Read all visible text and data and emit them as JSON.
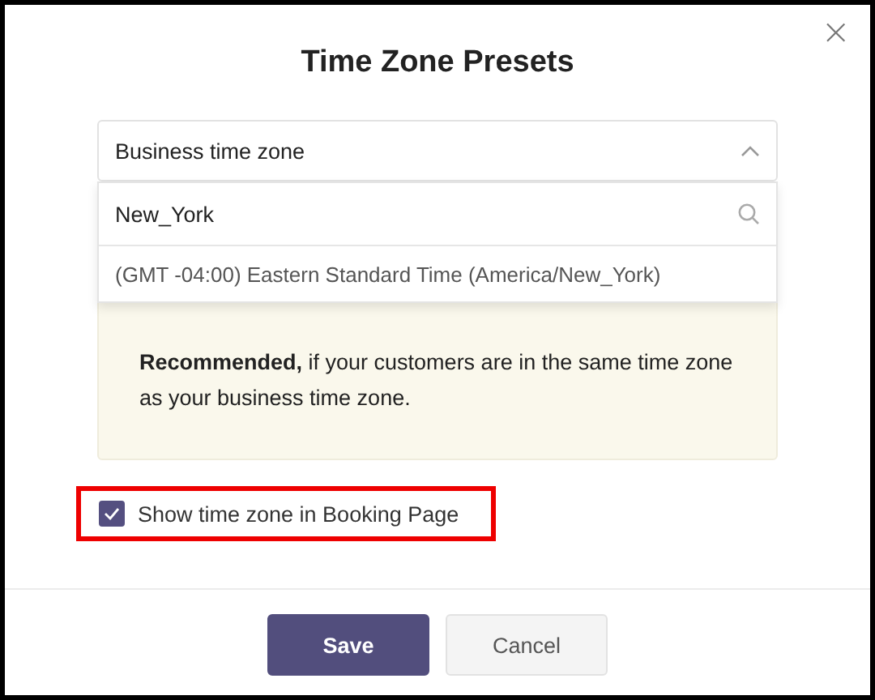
{
  "dialog": {
    "title": "Time Zone Presets",
    "close_label": "×"
  },
  "select": {
    "value": "Business time zone",
    "expanded": true
  },
  "dropdown": {
    "search_value": "New_York",
    "options": [
      {
        "label": "(GMT -04:00) Eastern Standard Time (America/New_York)",
        "selected": false
      }
    ]
  },
  "note": {
    "paragraphs": [
      "**Recommended,** if your customers are in the same time zone as your business time zone."
    ]
  },
  "option": {
    "label": "Show time zone in Booking Page",
    "checked": true,
    "highlighted": true
  },
  "buttons": [
    {
      "label": "Save",
      "kind": "primary"
    },
    {
      "label": "Cancel",
      "kind": "secondary"
    }
  ]
}
